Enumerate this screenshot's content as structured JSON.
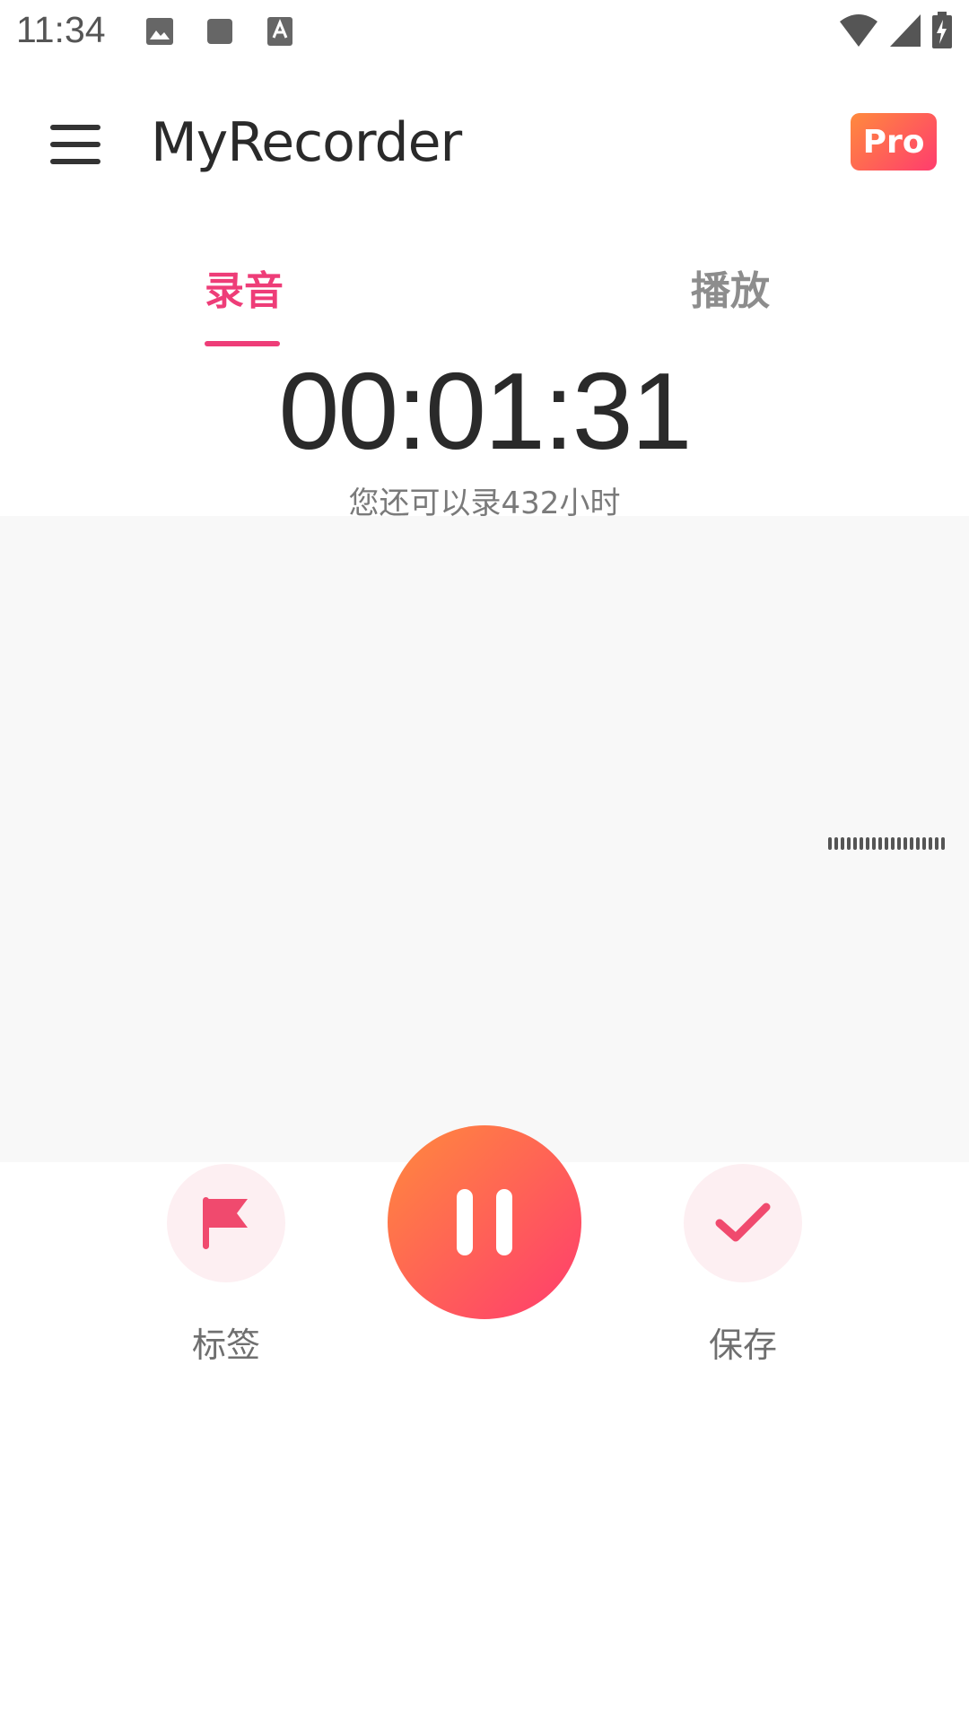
{
  "status_bar": {
    "time": "11:34",
    "left_icons": [
      "gallery-icon",
      "square-icon",
      "font-a-icon"
    ],
    "right_icons": [
      "wifi-icon",
      "cell-signal-icon",
      "battery-charging-icon"
    ]
  },
  "app_bar": {
    "title": "MyRecorder",
    "pro_badge": "Pro"
  },
  "tabs": [
    {
      "label": "录音",
      "active": true
    },
    {
      "label": "播放",
      "active": false
    }
  ],
  "recording": {
    "timer": "00:01:31",
    "remaining": "您还可以录432小时"
  },
  "controls": {
    "tag_label": "标签",
    "save_label": "保存",
    "tag_icon": "flag-icon",
    "save_icon": "check-icon",
    "main_icon": "pause-icon"
  },
  "colors": {
    "accent": "#ee3d78",
    "gradient_start": "#ff8a3d",
    "gradient_end": "#ff3c6e",
    "control_bg": "#fdeff2"
  }
}
